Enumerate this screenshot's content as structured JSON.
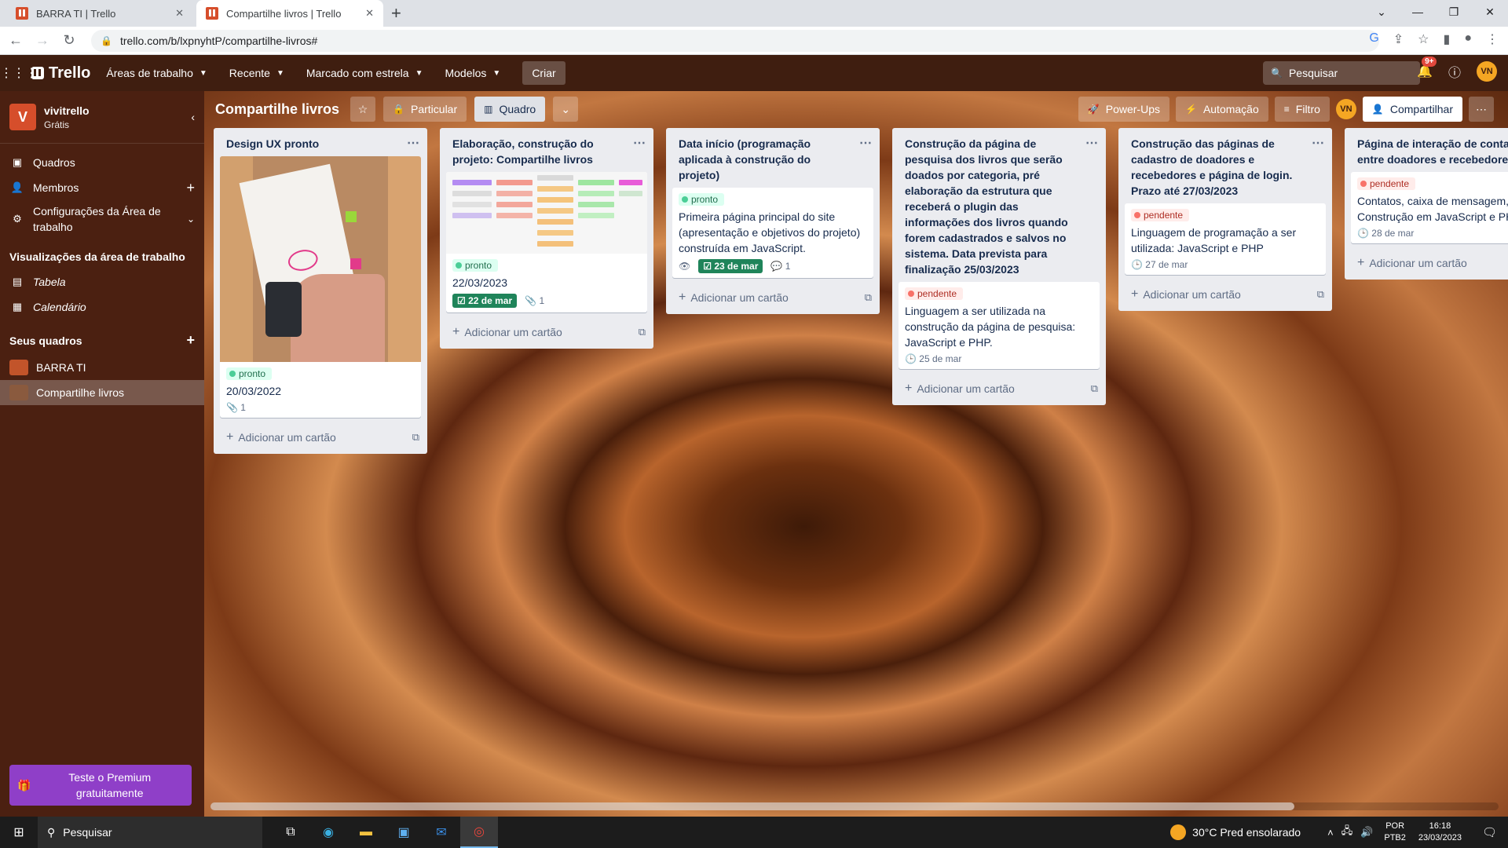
{
  "browser": {
    "tabs": [
      {
        "title": "BARRA TI | Trello",
        "active": false
      },
      {
        "title": "Compartilhe livros | Trello",
        "active": true
      }
    ],
    "url": "trello.com/b/lxpnyhtP/compartilhe-livros#"
  },
  "header": {
    "logo": "Trello",
    "menus": [
      "Áreas de trabalho",
      "Recente",
      "Marcado com estrela",
      "Modelos"
    ],
    "create": "Criar",
    "search_placeholder": "Pesquisar",
    "notifications": "9+",
    "avatar": "VN"
  },
  "sidebar": {
    "workspace_initial": "V",
    "workspace_name": "vivitrello",
    "workspace_plan": "Grátis",
    "nav": [
      {
        "label": "Quadros",
        "icon": "trello-icon"
      },
      {
        "label": "Membros",
        "icon": "person-icon"
      },
      {
        "label": "Configurações da Área de trabalho",
        "icon": "gear-icon"
      }
    ],
    "views_heading": "Visualizações da área de trabalho",
    "views": [
      {
        "label": "Tabela",
        "icon": "table-icon"
      },
      {
        "label": "Calendário",
        "icon": "calendar-icon"
      }
    ],
    "boards_heading": "Seus quadros",
    "boards": [
      {
        "label": "BARRA TI",
        "color": "#c2542a"
      },
      {
        "label": "Compartilhe livros",
        "color": "#8a5a3e"
      }
    ],
    "premium": "Teste o Premium gratuitamente"
  },
  "board": {
    "title": "Compartilhe livros",
    "visibility": "Particular",
    "view": "Quadro",
    "powerups": "Power-Ups",
    "automation": "Automação",
    "filter": "Filtro",
    "share": "Compartilhar",
    "add_card": "Adicionar um cartão",
    "lists": [
      {
        "title": "Design UX pronto",
        "cards": [
          {
            "label": "pronto",
            "text": "20/03/2022",
            "attachments": "1"
          }
        ]
      },
      {
        "title": "Elaboração, construção do projeto: Compartilhe livros",
        "cards": [
          {
            "label": "pronto",
            "text": "22/03/2023",
            "due": "22 de mar",
            "attachments": "1"
          }
        ]
      },
      {
        "title": "Data início (programação aplicada à construção do projeto)",
        "cards": [
          {
            "label": "pronto",
            "text": "Primeira página principal do site (apresentação e objetivos do projeto) construída em JavaScript.",
            "due": "23 de mar",
            "comments": "1"
          }
        ]
      },
      {
        "title": "Construção da página de pesquisa dos livros que serão doados por categoria, pré elaboração da estrutura que receberá o plugin das informações dos livros quando forem cadastrados e salvos no sistema. Data prevista para finalização 25/03/2023",
        "cards": [
          {
            "label": "pendente",
            "text": "Linguagem a ser utilizada na construção da página de pesquisa: JavaScript e PHP.",
            "due": "25 de mar"
          }
        ]
      },
      {
        "title": "Construção das páginas de cadastro de doadores e recebedores e página de login. Prazo até 27/03/2023",
        "cards": [
          {
            "label": "pendente",
            "text": "Linguagem de programação a ser utilizada: JavaScript e PHP",
            "due": "27 de mar"
          }
        ]
      },
      {
        "title": "Página de interação de contato entre doadores e recebedores.",
        "cards": [
          {
            "label": "pendente",
            "text": "Contatos, caixa de mensagem, etc. Construção em JavaScript e PHP",
            "due": "28 de mar"
          }
        ]
      }
    ]
  },
  "taskbar": {
    "search": "Pesquisar",
    "weather": "30°C  Pred ensolarado",
    "lang1": "POR",
    "lang2": "PTB2",
    "time": "16:18",
    "date": "23/03/2023"
  }
}
